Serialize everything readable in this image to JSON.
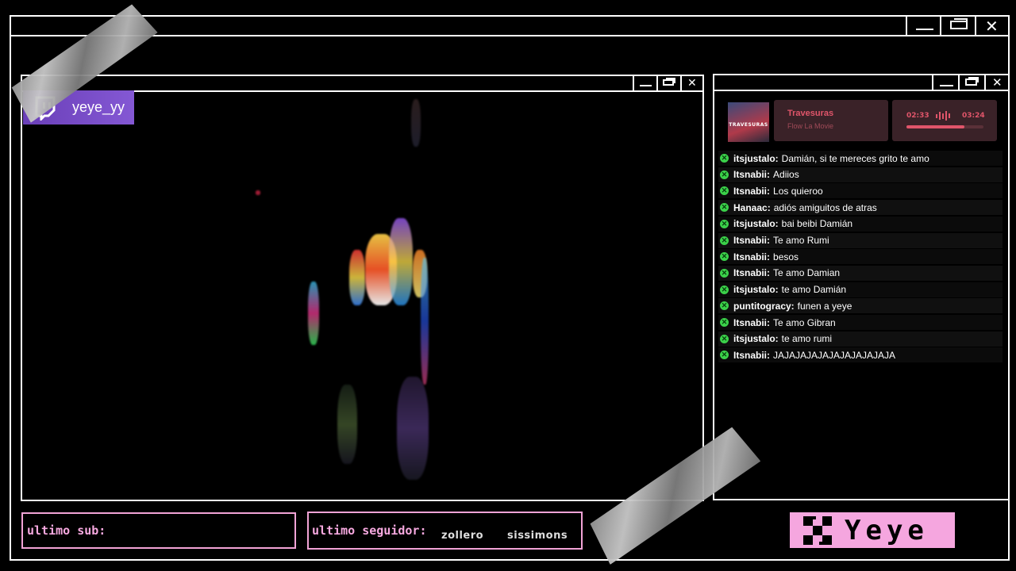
{
  "streamer": {
    "name": "yeye_yy",
    "platform_icon": "twitch-icon"
  },
  "window_controls": {
    "minimize": "minimize-icon",
    "restore": "restore-icon",
    "close": "close-icon"
  },
  "music": {
    "track_title": "Travesuras",
    "artist": "Flow La Movie",
    "album_art_text": "TRAVESURAS",
    "time_current": "02:33",
    "time_total": "03:24",
    "progress": 0.75,
    "accent": "#e0556a"
  },
  "chat": {
    "messages": [
      {
        "user": "itsjustalo:",
        "text": "Damián, si te mereces grito te amo"
      },
      {
        "user": "Itsnabii:",
        "text": "Adiios"
      },
      {
        "user": "Itsnabii:",
        "text": "Los quieroo"
      },
      {
        "user": "Hanaac:",
        "text": "adiós amiguitos de atras"
      },
      {
        "user": "itsjustalo:",
        "text": "bai beibi Damián"
      },
      {
        "user": "Itsnabii:",
        "text": "Te amo Rumi"
      },
      {
        "user": "Itsnabii:",
        "text": "besos"
      },
      {
        "user": "Itsnabii:",
        "text": "Te amo Damian"
      },
      {
        "user": "itsjustalo:",
        "text": "te amo Damián"
      },
      {
        "user": "puntitogracy:",
        "text": "funen a yeye"
      },
      {
        "user": "Itsnabii:",
        "text": "Te amo Gibran"
      },
      {
        "user": "itsjustalo:",
        "text": "te amo rumi"
      },
      {
        "user": "Itsnabii:",
        "text": "JAJAJAJAJAJAJAJAJAJAJA"
      }
    ]
  },
  "footer": {
    "last_sub_label": "ultimo sub:",
    "last_sub_value": "",
    "last_follower_label": "ultimo seguidor:",
    "last_follower_values": [
      "zollero",
      "sissimons"
    ],
    "brand_name": "Yeye",
    "brand_color": "#f5a6df"
  }
}
